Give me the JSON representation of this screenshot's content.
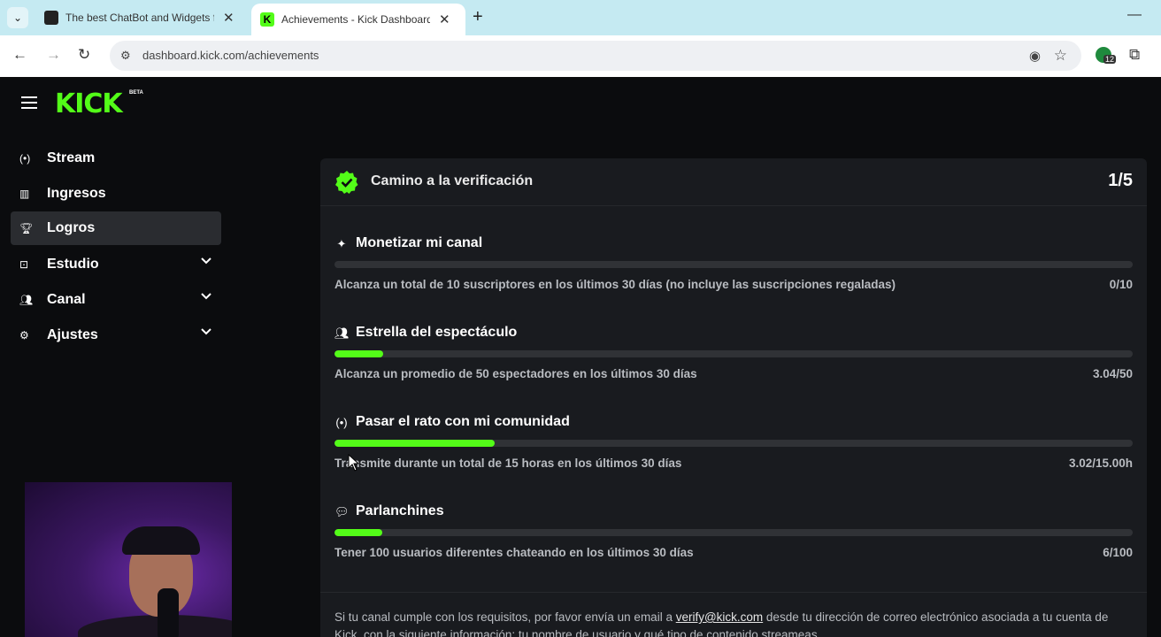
{
  "browser": {
    "tabs": [
      {
        "title": "The best ChatBot and Widgets f",
        "active": false
      },
      {
        "title": "Achievements - Kick Dashboard",
        "active": true
      }
    ],
    "url": "dashboard.kick.com/achievements",
    "extension_badge": "12"
  },
  "header": {
    "logo": "KICK",
    "badge": "BETA"
  },
  "sidebar": {
    "items": [
      {
        "label": "Stream",
        "icon": "broadcast-icon",
        "active": false,
        "expandable": false
      },
      {
        "label": "Ingresos",
        "icon": "chart-icon",
        "active": false,
        "expandable": false
      },
      {
        "label": "Logros",
        "icon": "trophy-icon",
        "active": true,
        "expandable": false
      },
      {
        "label": "Estudio",
        "icon": "studio-icon",
        "active": false,
        "expandable": true
      },
      {
        "label": "Canal",
        "icon": "users-icon",
        "active": false,
        "expandable": true
      },
      {
        "label": "Ajustes",
        "icon": "gear-icon",
        "active": false,
        "expandable": true
      }
    ]
  },
  "card": {
    "title": "Camino a la verificación",
    "count": "1/5",
    "achievements": [
      {
        "title": "Monetizar mi canal",
        "icon": "sparkle-icon",
        "description": "Alcanza un total de 10 suscriptores en los últimos 30 días (no incluye las suscripciones regaladas)",
        "value": "0/10",
        "progress": 0.0
      },
      {
        "title": "Estrella del espectáculo",
        "icon": "users-icon",
        "description": "Alcanza un promedio de 50 espectadores en los últimos 30 días",
        "value": "3.04/50",
        "progress": 0.061
      },
      {
        "title": "Pasar el rato con mi comunidad",
        "icon": "broadcast-icon",
        "description": "Transmite durante un total de 15 horas en los últimos 30 días",
        "value": "3.02/15.00h",
        "progress": 0.201
      },
      {
        "title": "Parlanchines",
        "icon": "chat-icon",
        "description": "Tener 100 usuarios diferentes chateando en los últimos 30 días",
        "value": "6/100",
        "progress": 0.06
      }
    ],
    "footnote": {
      "before": "Si tu canal cumple con los requisitos, por favor envía un email a ",
      "email": "verify@kick.com",
      "after": " desde tu dirección de correo electrónico asociada a tu cuenta de Kick, con la siguiente información: tu nombre de usuario y qué tipo de contenido streameas."
    }
  },
  "colors": {
    "accent": "#53fc18",
    "background": "#0b0c0e",
    "card": "#191b1f"
  }
}
